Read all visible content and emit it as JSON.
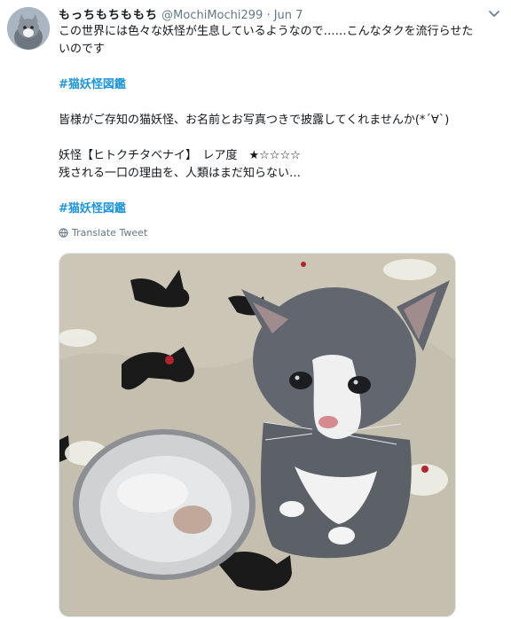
{
  "tweet": {
    "display_name": "もっちもちももち",
    "handle": "@MochiMochi299",
    "separator": " · ",
    "date": "Jun 7",
    "lines": [
      "この世界には色々な妖怪が生息しているようなので……こんなタクを流行らせた",
      "いのです"
    ],
    "hashtag_1": "#猫妖怪図鑑",
    "line_invite": "皆様がご存知の猫妖怪、お名前とお写真つきで披露してくれませんか(*´∀`)",
    "line_yokai": "妖怪【ヒトクチタベナイ】　レア度　★☆☆☆☆",
    "line_mystery": "残される一口の理由を、人類はまだ知らない…",
    "hashtag_2": "#猫妖怪図鑑",
    "translate_label": "Translate Tweet"
  },
  "colors": {
    "link": "#1b95e0",
    "muted": "#657786",
    "text": "#14171a"
  },
  "icons": {
    "chevron": "chevron-down-icon",
    "globe": "globe-icon"
  }
}
